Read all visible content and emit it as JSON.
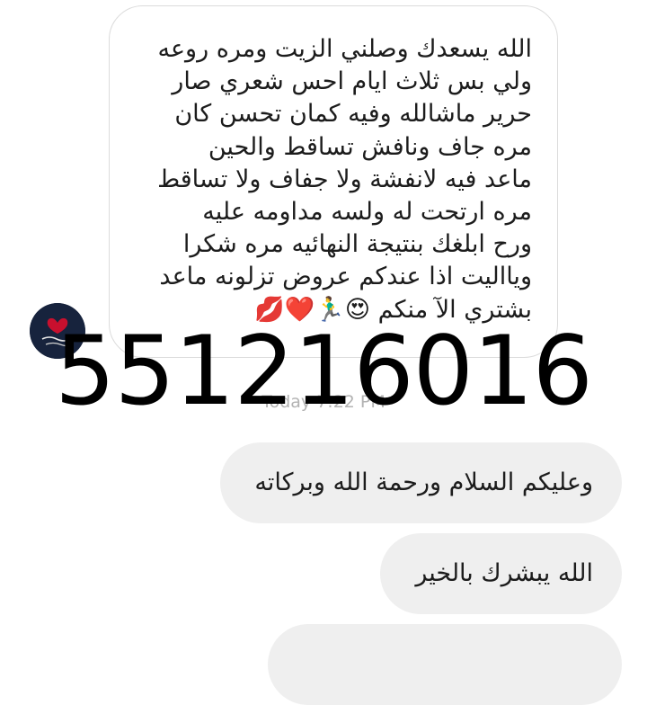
{
  "incoming_message": {
    "text": "الله يسعدك وصلني الزيت ومره روعه\nولي بس ثلاث ايام احس شعري صار\nحرير ماشالله وفيه كمان تحسن كان\nمره جاف ونافش تساقط  والحين\nماعد فيه لانفشة ولا جفاف ولا تساقط\nمره ارتحت له ولسه مداومه عليه\nورح ابلغك بنتيجة  النهائيه مره شكرا\nويااليت اذا عندكم عروض تزلونه ماعد\nبشتري الآ منكم 😍🏃‍♂️❤️💋"
  },
  "timestamp": "Today 7:22 PM",
  "watermark_number": "551216016",
  "outgoing_messages": [
    "وعليكم السلام ورحمة الله وبركاته",
    "الله يبشرك بالخير",
    ""
  ],
  "colors": {
    "incoming_border": "#dcdcdc",
    "outgoing_bubble": "#efefef",
    "timestamp": "#b3b3b3",
    "watermark": "#000000"
  },
  "icons": {
    "avatar": "profile-avatar-icon"
  }
}
